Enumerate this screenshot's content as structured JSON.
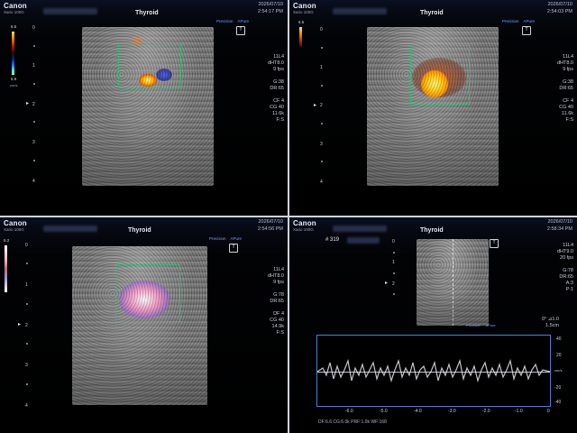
{
  "header": {
    "brand": "Canon",
    "model": "Xario 100G",
    "exam": "Thyroid",
    "tags": [
      "Precision",
      "APure"
    ],
    "probe_mark": "T"
  },
  "panels": [
    {
      "date": "2026/07/10",
      "time": "2:54:17 PM",
      "depths": [
        "0",
        "1",
        "2",
        "3",
        "4"
      ],
      "cbar_top": "6.5",
      "cbar_bottom": "6.5",
      "cbar_units": "cm/s",
      "params": [
        "11L4",
        "dHT8.0",
        "9 fps",
        "",
        "G:38",
        "DR:65",
        "",
        "CF 4",
        "CG 40",
        "11.6k",
        "F:S"
      ]
    },
    {
      "date": "2026/07/10",
      "time": "2:54:03 PM",
      "depths": [
        "0",
        "1",
        "2",
        "3",
        "4"
      ],
      "cbar_top": "6.5",
      "params": [
        "11L4",
        "dHT8.0",
        "9 fps",
        "",
        "G:38",
        "DR:65",
        "",
        "CF 4",
        "CG 40",
        "11.6k",
        "F:S"
      ]
    },
    {
      "date": "2026/07/10",
      "time": "2:54:56 PM",
      "depths": [
        "0",
        "1",
        "2",
        "3",
        "4"
      ],
      "cbar_top": "6.2",
      "params": [
        "11L4",
        "dHT8.0",
        "9 fps",
        "",
        "G:78",
        "DR:65",
        "",
        "DF 4",
        "CG 40",
        "14.9k",
        "F:S"
      ]
    },
    {
      "date": "2026/07/10",
      "time": "2:58:34 PM",
      "depths": [
        "0",
        "1",
        "2"
      ],
      "frame": "# 319",
      "params": [
        "11L4",
        "dHT9.0",
        "20 fps",
        "",
        "G:78",
        "DR:65",
        "A:3",
        "P:1"
      ],
      "angle": "0°  ⊿1.0",
      "gate": "1.5cm",
      "spectral_y": [
        "40",
        "20",
        "cm/s",
        "-20",
        "-40"
      ],
      "spectral_x": [
        "-6.0",
        "-5.0",
        "-4.0",
        "-3.0",
        "-2.0",
        "-1.0",
        "0"
      ],
      "bottom": "DF:6.6   CG:6.0k   PRF:1.0k   WF:168"
    }
  ],
  "colors": {
    "roi": "#2ec27a",
    "tag": "#6ea2ff",
    "spectral_border": "#4a7fd6"
  }
}
